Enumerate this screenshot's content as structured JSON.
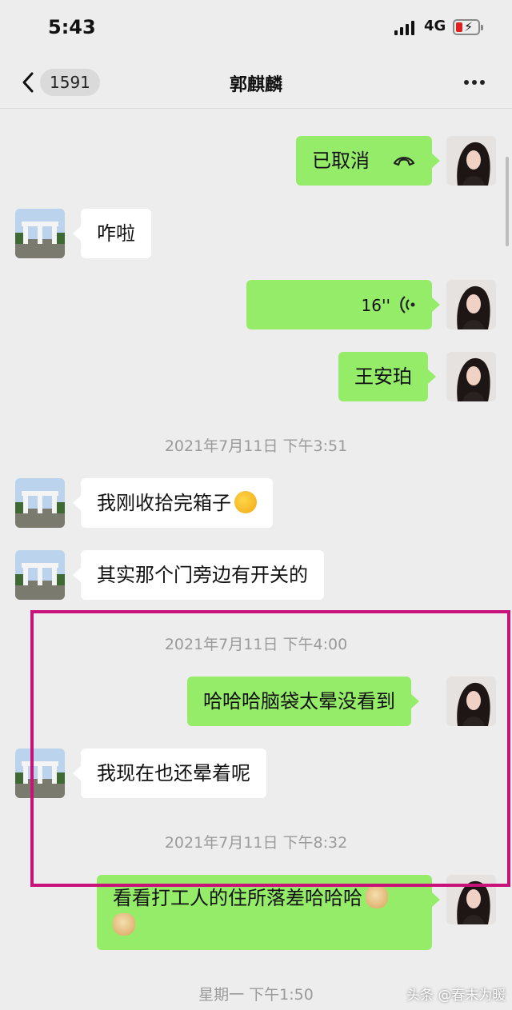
{
  "status_bar": {
    "time": "5:43",
    "network": "4G"
  },
  "header": {
    "back_count": "1591",
    "title": "郭麒麟"
  },
  "messages": [
    {
      "side": "out",
      "text": "已取消",
      "icon": "phone-hangup-icon"
    },
    {
      "side": "in",
      "text": "咋啦"
    },
    {
      "side": "out",
      "text": "16''",
      "icon": "voice-icon"
    },
    {
      "side": "out",
      "text": "王安珀"
    },
    {
      "timestamp": "2021年7月11日 下午3:51"
    },
    {
      "side": "in",
      "text": "我刚收拾完箱子",
      "emoji": "laughing-crying-emoji"
    },
    {
      "side": "in",
      "text": "其实那个门旁边有开关的"
    },
    {
      "timestamp": "2021年7月11日 下午4:00"
    },
    {
      "side": "out",
      "text": "哈哈哈脑袋太晕没看到"
    },
    {
      "side": "in",
      "text": "我现在也还晕着呢"
    },
    {
      "timestamp": "2021年7月11日 下午8:32"
    },
    {
      "side": "out",
      "text": "看看打工人的住所落差哈哈哈",
      "emoji": "doge-emoji"
    },
    {
      "timestamp": "星期一 下午1:50"
    }
  ],
  "annotation": {
    "color": "#c8127a"
  },
  "colors": {
    "outgoing": "#95ec69",
    "incoming": "#ffffff",
    "background": "#ededed"
  },
  "watermark": "头条 @春末为暖"
}
